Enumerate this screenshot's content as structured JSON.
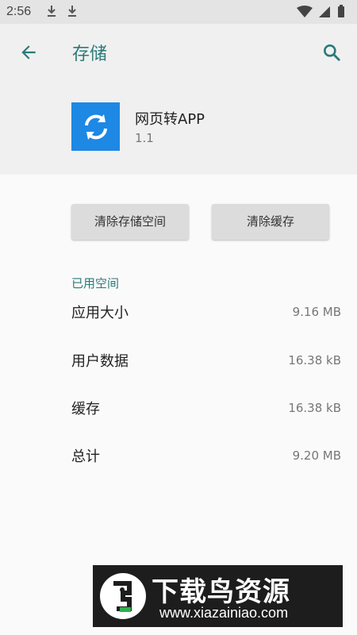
{
  "status_bar": {
    "time": "2:56",
    "icons": [
      "download-icon",
      "download-icon",
      "wifi-icon",
      "signal-icon",
      "battery-icon"
    ]
  },
  "app_bar": {
    "title": "存储",
    "back_icon": "arrow-back-icon",
    "search_icon": "search-icon"
  },
  "app_info": {
    "name": "网页转APP",
    "version": "1.1",
    "icon": "sync-icon",
    "icon_color": "#1e88e5"
  },
  "actions": {
    "clear_storage": "清除存储空间",
    "clear_cache": "清除缓存"
  },
  "storage": {
    "section_title": "已用空间",
    "rows": [
      {
        "label": "应用大小",
        "value": "9.16 MB"
      },
      {
        "label": "用户数据",
        "value": "16.38 kB"
      },
      {
        "label": "缓存",
        "value": "16.38 kB"
      },
      {
        "label": "总计",
        "value": "9.20 MB"
      }
    ]
  },
  "watermark": {
    "title": "下载鸟资源",
    "url": "www.xiazainiao.com"
  },
  "colors": {
    "accent": "#2a7a78",
    "app_icon_bg": "#1e88e5"
  }
}
